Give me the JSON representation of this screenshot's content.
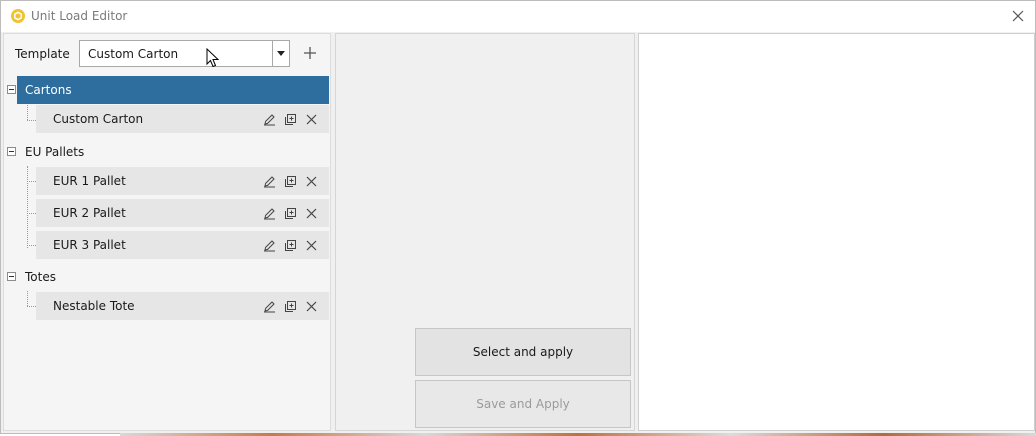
{
  "window": {
    "title": "Unit Load Editor"
  },
  "template": {
    "label": "Template",
    "value": "Custom Carton"
  },
  "tree": {
    "groups": [
      {
        "label": "Cartons",
        "items": [
          "Custom Carton"
        ]
      },
      {
        "label": "EU Pallets",
        "items": [
          "EUR 1 Pallet",
          "EUR 2 Pallet",
          "EUR 3 Pallet"
        ]
      },
      {
        "label": "Totes",
        "items": [
          "Nestable Tote"
        ]
      }
    ]
  },
  "actions": {
    "select_apply": "Select and apply",
    "save_apply": "Save and Apply"
  },
  "colors": {
    "selection": "#2e6e9e",
    "app_icon": "#f2c230"
  }
}
